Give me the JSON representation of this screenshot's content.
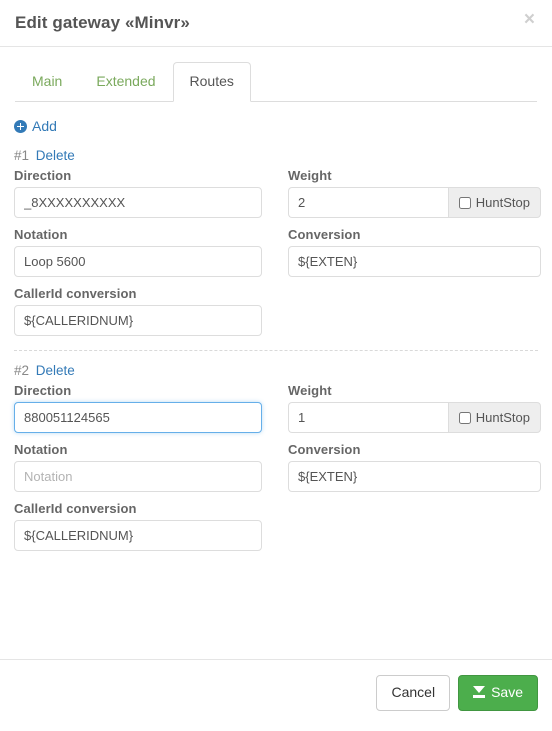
{
  "header": {
    "title": "Edit gateway «Minvr»",
    "close_label": "×"
  },
  "tabs": [
    {
      "label": "Main",
      "active": false
    },
    {
      "label": "Extended",
      "active": false
    },
    {
      "label": "Routes",
      "active": true
    }
  ],
  "toolbar": {
    "add_label": "Add",
    "add_icon": "plus-circle-icon"
  },
  "labels": {
    "direction": "Direction",
    "weight": "Weight",
    "notation": "Notation",
    "conversion": "Conversion",
    "callerid_conversion": "CallerId conversion",
    "huntstop": "HuntStop",
    "delete": "Delete"
  },
  "routes": [
    {
      "index_label": "#1",
      "direction_value": "_8XXXXXXXXXX",
      "direction_placeholder": "Direction",
      "direction_focused": false,
      "weight_value": "2",
      "weight_placeholder": "Weight",
      "huntstop_checked": false,
      "notation_value": "Loop 5600",
      "notation_placeholder": "Notation",
      "conversion_value": "${EXTEN}",
      "conversion_placeholder": "Conversion",
      "callerid_value": "${CALLERIDNUM}",
      "callerid_placeholder": "CallerId conversion"
    },
    {
      "index_label": "#2",
      "direction_value": "880051124565",
      "direction_placeholder": "Direction",
      "direction_focused": true,
      "weight_value": "1",
      "weight_placeholder": "Weight",
      "huntstop_checked": false,
      "notation_value": "",
      "notation_placeholder": "Notation",
      "conversion_value": "${EXTEN}",
      "conversion_placeholder": "Conversion",
      "callerid_value": "${CALLERIDNUM}",
      "callerid_placeholder": "CallerId conversion"
    }
  ],
  "footer": {
    "cancel_label": "Cancel",
    "save_label": "Save",
    "save_icon": "download-icon"
  },
  "colors": {
    "link_blue": "#337ab7",
    "tab_green": "#7aa95c",
    "save_green": "#4cae4c",
    "focus_blue": "#66afe9"
  }
}
